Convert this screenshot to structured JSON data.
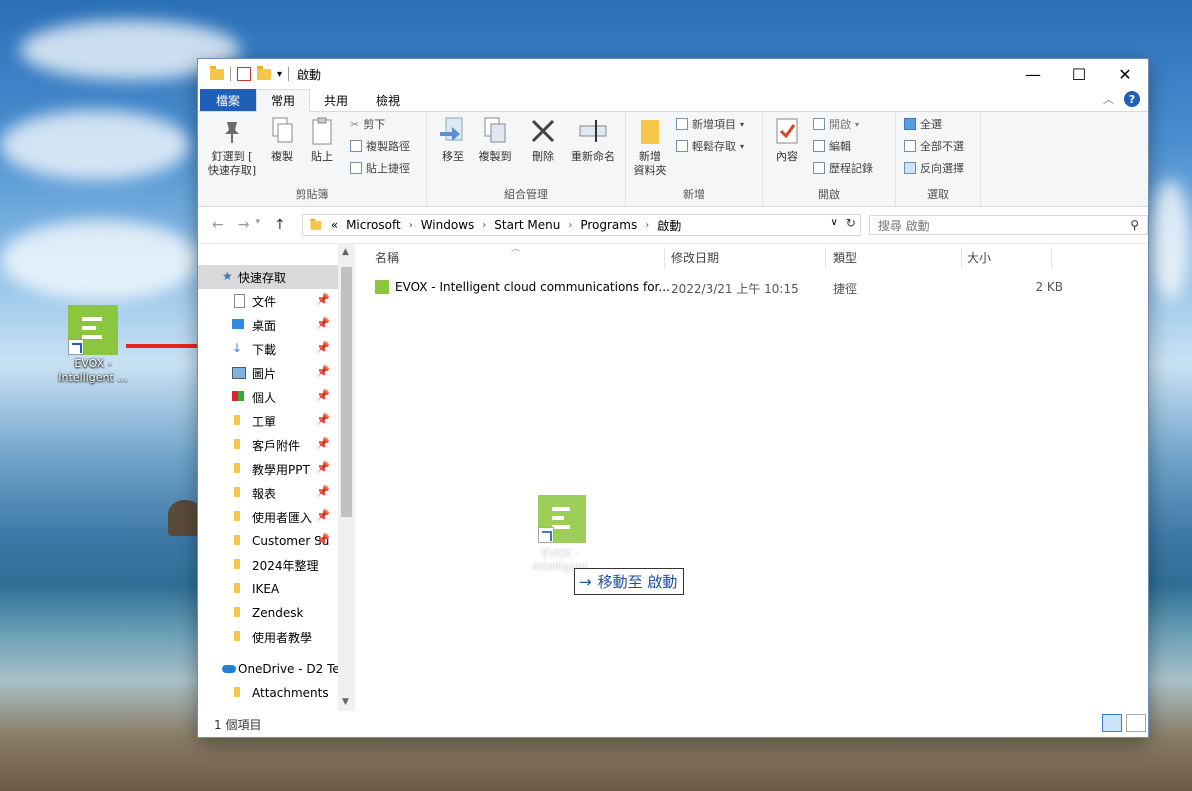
{
  "desktop": {
    "icon_label": "EVOX - Intelligent ..."
  },
  "window": {
    "title": "啟動",
    "controls": {
      "minimize": "—",
      "maximize": "☐",
      "close": "✕"
    }
  },
  "tabs": [
    {
      "label": "檔案"
    },
    {
      "label": "常用"
    },
    {
      "label": "共用"
    },
    {
      "label": "檢視"
    }
  ],
  "ribbon": {
    "clipboard": {
      "label": "剪貼簿",
      "pin": "釘選到 [\n快速存取]",
      "copy": "複製",
      "paste": "貼上",
      "cut": "剪下",
      "copy_path": "複製路徑",
      "paste_shortcut": "貼上捷徑"
    },
    "organize": {
      "label": "組合管理",
      "move_to": "移至",
      "copy_to": "複製到",
      "delete": "刪除",
      "rename": "重新命名"
    },
    "new": {
      "label": "新增",
      "new_folder": "新增\n資料夾",
      "new_item": "新增項目",
      "easy_access": "輕鬆存取"
    },
    "open": {
      "label": "開啟",
      "properties": "內容",
      "open": "開啟",
      "edit": "編輯",
      "history": "歷程記錄"
    },
    "select": {
      "label": "選取",
      "select_all": "全選",
      "select_none": "全部不選",
      "invert": "反向選擇"
    }
  },
  "address": {
    "prefix": "«",
    "crumbs": [
      "Microsoft",
      "Windows",
      "Start Menu",
      "Programs",
      "啟動"
    ]
  },
  "search": {
    "placeholder": "搜尋 啟動"
  },
  "nav": {
    "items": [
      {
        "label": "快速存取",
        "pinned": false
      },
      {
        "label": "文件",
        "pinned": true
      },
      {
        "label": "桌面",
        "pinned": true
      },
      {
        "label": "下載",
        "pinned": true
      },
      {
        "label": "圖片",
        "pinned": true
      },
      {
        "label": "個人",
        "pinned": true
      },
      {
        "label": "工單",
        "pinned": true
      },
      {
        "label": "客戶附件",
        "pinned": true
      },
      {
        "label": "教學用PPT",
        "pinned": true
      },
      {
        "label": "報表",
        "pinned": true
      },
      {
        "label": "使用者匯入",
        "pinned": true
      },
      {
        "label": "Customer Su",
        "pinned": true
      },
      {
        "label": "2024年整理",
        "pinned": false
      },
      {
        "label": "IKEA",
        "pinned": false
      },
      {
        "label": "Zendesk",
        "pinned": false
      },
      {
        "label": "使用者教學",
        "pinned": false
      },
      {
        "label": "OneDrive - D2 Te",
        "pinned": false
      },
      {
        "label": "Attachments",
        "pinned": false
      }
    ]
  },
  "columns": {
    "name": "名稱",
    "date": "修改日期",
    "type": "類型",
    "size": "大小"
  },
  "files": [
    {
      "name": "EVOX - Intelligent cloud communications for...",
      "date": "2022/3/21 上午 10:15",
      "type": "捷徑",
      "size": "2 KB"
    }
  ],
  "drag": {
    "ghost_label": "EVOX - Intelligent",
    "tooltip": "移動至 啟動"
  },
  "status": {
    "count": "1 個項目"
  },
  "colors": {
    "accent": "#1f5fb8",
    "app_green": "#8cc63e",
    "arrow_red": "#e8251f"
  }
}
